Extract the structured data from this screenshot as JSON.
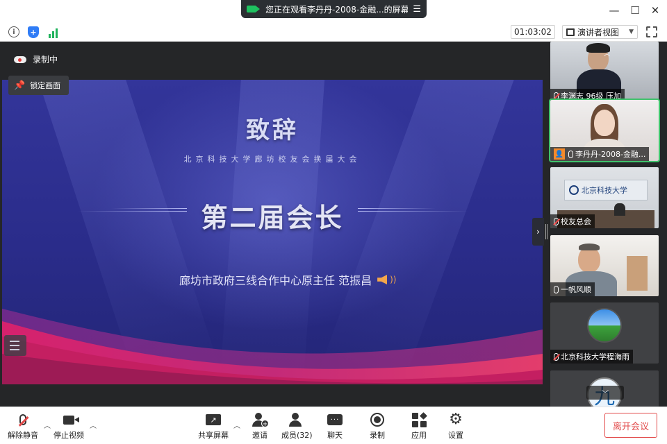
{
  "titlebar": {
    "share_notice": "您正在观看李丹丹-2008-金融...的屏幕",
    "menu_icon": "menu-icon",
    "controls": [
      "minimize-icon",
      "maximize-icon",
      "close-icon"
    ]
  },
  "infobar": {
    "timer": "01:03:02",
    "view_mode": "演讲者视图",
    "icons": [
      "info-icon",
      "shield-icon",
      "signal-bars-icon",
      "fullscreen-icon"
    ]
  },
  "stage": {
    "recording_label": "录制中",
    "lock_label": "锁定画面",
    "slide": {
      "title": "致辞",
      "subtitle": "北京科技大学廊坊校友会换届大会",
      "role": "第二届会长",
      "speaker": "廊坊市政府三线合作中心原主任 范振昌"
    }
  },
  "participants": [
    {
      "name": "李渊志 96级 压加",
      "muted": true,
      "active": false,
      "host": false
    },
    {
      "name": "李丹丹-2008-金融...",
      "muted": false,
      "active": true,
      "host": true
    },
    {
      "name": "校友总会",
      "muted": true,
      "active": false,
      "host": false,
      "wall_text": "北京科技大学"
    },
    {
      "name": "一帆风顺",
      "muted": false,
      "active": false,
      "host": false
    },
    {
      "name": "北京科技大学程海雨",
      "muted": true,
      "active": false,
      "host": false
    },
    {
      "name": "",
      "muted": false,
      "active": false,
      "host": false,
      "avatar_glyph": "九"
    }
  ],
  "toolbar": {
    "unmute": "解除静音",
    "stop_video": "停止视频",
    "share_screen": "共享屏幕",
    "invite": "邀请",
    "members": "成员(32)",
    "chat": "聊天",
    "record": "录制",
    "apps": "应用",
    "settings": "设置",
    "leave": "离开会议"
  },
  "colors": {
    "accent_green": "#1ec15f",
    "danger_red": "#e24a4a",
    "slide_blue": "#2a2c8a",
    "slide_magenta": "#d6226d"
  }
}
